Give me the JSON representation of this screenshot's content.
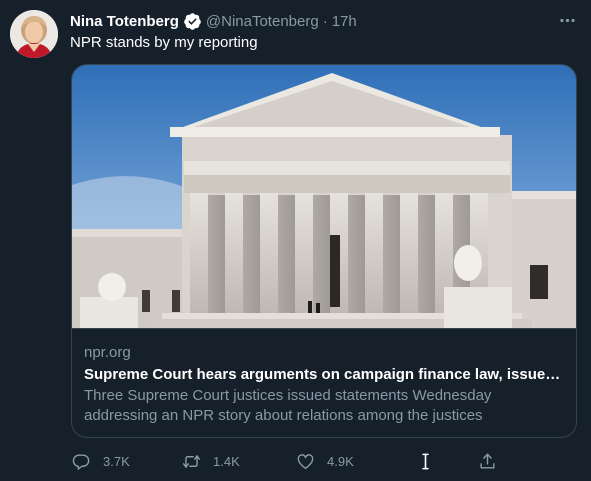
{
  "tweet": {
    "author_name": "Nina Totenberg",
    "handle": "@NinaTotenberg",
    "separator": "·",
    "time": "17h",
    "text": "NPR stands by my reporting"
  },
  "card": {
    "image_subject": "Supreme Court building",
    "domain": "npr.org",
    "title": "Supreme Court hears arguments on campaign finance law, issues stat...",
    "description": "Three Supreme Court justices issued statements Wednesday addressing an NPR story about relations among the justices"
  },
  "actions": {
    "replies": "3.7K",
    "retweets": "1.4K",
    "likes": "4.9K"
  },
  "icons": {
    "verified": "verified-badge-icon",
    "more": "more-options-icon",
    "reply": "reply-icon",
    "retweet": "retweet-icon",
    "like": "heart-icon",
    "cursor": "text-cursor-icon",
    "share": "share-icon"
  },
  "colors": {
    "background": "#15202b",
    "primary_text": "#ffffff",
    "secondary_text": "#8b98a5",
    "border": "#38444d",
    "verified": "#ffffff"
  }
}
